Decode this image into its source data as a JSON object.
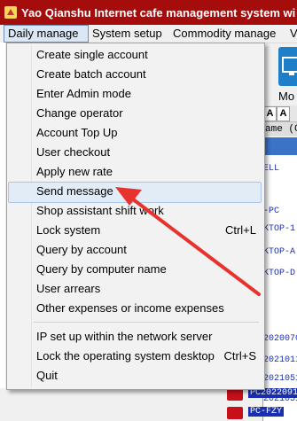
{
  "window": {
    "title": "Yao Qianshu Internet cafe management system wi"
  },
  "menubar": {
    "items": [
      "Daily manage",
      "System setup",
      "Commodity manage",
      "V"
    ]
  },
  "toolbar": {
    "button_label": "Mo"
  },
  "right_panel": {
    "font_buttons": [
      "A",
      "A"
    ],
    "column_header": "ame (Cl",
    "rows": [
      "ELL",
      "-PC",
      "KTOP-1",
      "KTOP-A",
      "KTOP-D",
      "2020070",
      "2021011",
      "2021051",
      "2021051"
    ]
  },
  "pc_items": [
    "PC20220915",
    "PC-FZY"
  ],
  "dropdown": {
    "items": [
      {
        "label": "Create single account",
        "shortcut": ""
      },
      {
        "label": "Create batch account",
        "shortcut": ""
      },
      {
        "label": "Enter Admin mode",
        "shortcut": ""
      },
      {
        "label": "Change operator",
        "shortcut": ""
      },
      {
        "label": "Account Top Up",
        "shortcut": ""
      },
      {
        "label": "User checkout",
        "shortcut": ""
      },
      {
        "label": "Apply new rate",
        "shortcut": ""
      },
      {
        "label": "Send message",
        "shortcut": ""
      },
      {
        "label": "Shop assistant shift work",
        "shortcut": ""
      },
      {
        "label": "Lock system",
        "shortcut": "Ctrl+L"
      },
      {
        "label": "Query by account",
        "shortcut": ""
      },
      {
        "label": "Query by computer name",
        "shortcut": ""
      },
      {
        "label": "User arrears",
        "shortcut": ""
      },
      {
        "label": "Other expenses or income expenses",
        "shortcut": ""
      },
      {
        "label": "IP set up within the network server",
        "shortcut": ""
      },
      {
        "label": "Lock the operating system desktop",
        "shortcut": "Ctrl+S"
      },
      {
        "label": "Quit",
        "shortcut": ""
      }
    ],
    "highlighted_index": 7
  },
  "colors": {
    "title_bar": "#a50c0c",
    "highlight": "#e2ecf7",
    "arrow": "#e8322e",
    "toolbar_blue": "#1e7fc8"
  }
}
